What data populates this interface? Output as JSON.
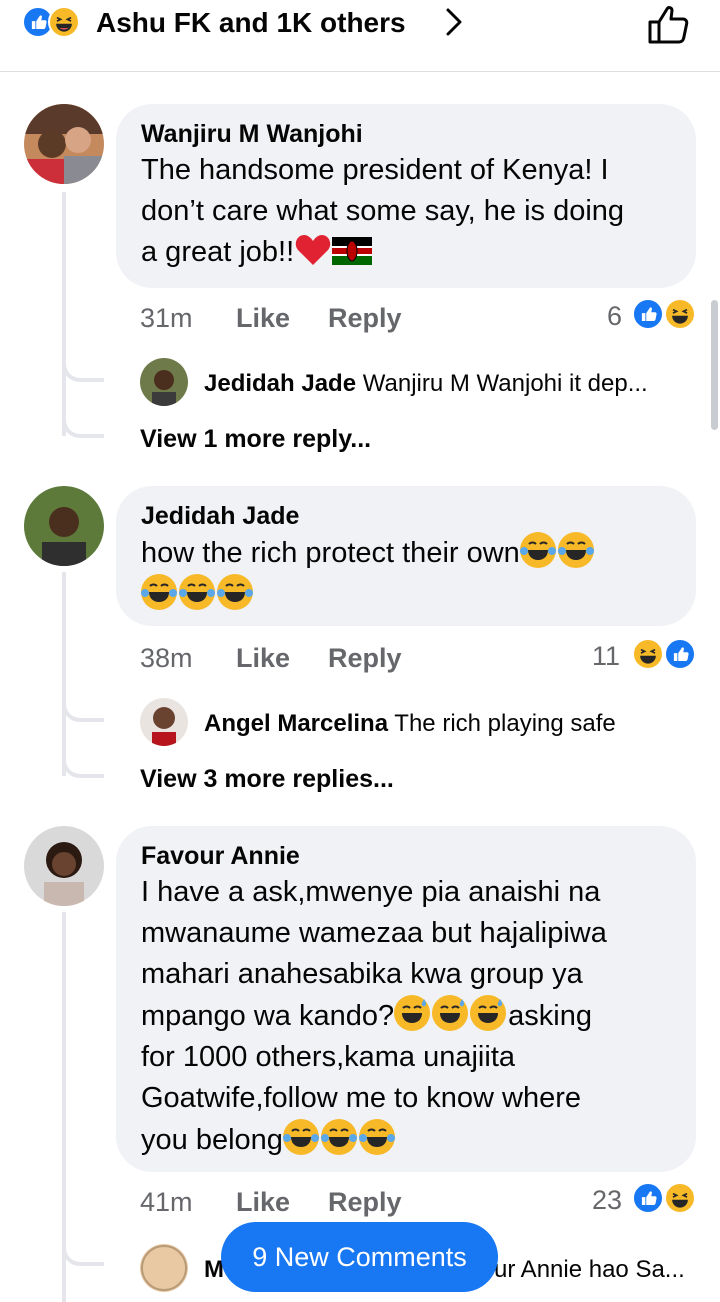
{
  "header": {
    "reaction_summary": "Ashu FK and 1K others",
    "reactions": [
      "like-icon",
      "haha-icon"
    ]
  },
  "comments": [
    {
      "name": "Wanjiru M Wanjohi",
      "text_lines": [
        "The handsome president of Kenya! I",
        "don’t care what some say, he is doing",
        "a great job!!"
      ],
      "time": "31m",
      "like_label": "Like",
      "reply_label": "Reply",
      "reaction_count": "6",
      "reply": {
        "name": "Jedidah Jade",
        "text": "Wanjiru M Wanjohi it dep..."
      },
      "view_more": "View 1 more reply..."
    },
    {
      "name": "Jedidah Jade",
      "text_lines": [
        "how the rich protect their own"
      ],
      "time": "38m",
      "like_label": "Like",
      "reply_label": "Reply",
      "reaction_count": "11",
      "reply": {
        "name": "Angel Marcelina",
        "text": "The rich playing safe"
      },
      "view_more": "View 3 more replies..."
    },
    {
      "name": "Favour Annie",
      "text_lines": [
        "I have a ask,mwenye pia anaishi na",
        "mwanaume wamezaa but hajalipiwa",
        "mahari anahesabika kwa group ya",
        "mpango wa kando?",
        "asking",
        "for 1000 others,kama unajiita",
        "Goatwife,follow me to know where",
        "you belong"
      ],
      "time": "41m",
      "like_label": "Like",
      "reply_label": "Reply",
      "reaction_count": "23",
      "reply": {
        "name": "M",
        "text": "ur Annie hao Sa..."
      }
    }
  ],
  "new_comments_button": "9 New Comments",
  "colors": {
    "accent": "#1877f2",
    "bubble": "#f0f2f5",
    "muted": "#65676b",
    "haha": "#f7b928"
  }
}
